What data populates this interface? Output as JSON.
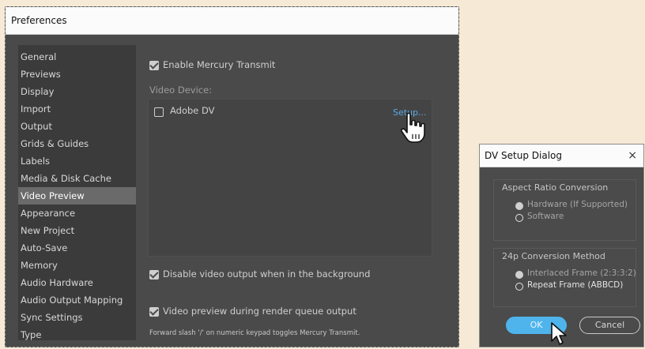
{
  "prefs": {
    "title": "Preferences",
    "sidebar": [
      {
        "label": "General"
      },
      {
        "label": "Previews"
      },
      {
        "label": "Display"
      },
      {
        "label": "Import"
      },
      {
        "label": "Output"
      },
      {
        "label": "Grids & Guides"
      },
      {
        "label": "Labels"
      },
      {
        "label": "Media & Disk Cache"
      },
      {
        "label": "Video Preview",
        "active": true
      },
      {
        "label": "Appearance"
      },
      {
        "label": "New Project"
      },
      {
        "label": "Auto-Save"
      },
      {
        "label": "Memory"
      },
      {
        "label": "Audio Hardware"
      },
      {
        "label": "Audio Output Mapping"
      },
      {
        "label": "Sync Settings"
      },
      {
        "label": "Type"
      }
    ],
    "enable_mercury": {
      "label": "Enable Mercury Transmit",
      "checked": true
    },
    "video_device_label": "Video Device:",
    "device": {
      "label": "Adobe DV",
      "checked": false
    },
    "setup_link": "Setup...",
    "disable_bg": {
      "label": "Disable video output when in the background",
      "checked": true
    },
    "render_queue": {
      "label": "Video preview during render queue output",
      "checked": true
    },
    "hint": "Forward slash '/' on numeric keypad toggles Mercury Transmit."
  },
  "dv_dialog": {
    "title": "DV Setup Dialog",
    "close_glyph": "×",
    "aspect": {
      "title": "Aspect Ratio Conversion",
      "options": [
        {
          "label": "Hardware (If Supported)",
          "selected": true
        },
        {
          "label": "Software",
          "selected": false
        }
      ]
    },
    "pulldown": {
      "title": "24p Conversion Method",
      "options": [
        {
          "label": "Interlaced Frame (2:3:3:2)",
          "selected": true
        },
        {
          "label": "Repeat Frame (ABBCD)",
          "selected": false
        }
      ]
    },
    "ok_label": "OK",
    "cancel_label": "Cancel"
  },
  "colors": {
    "accent": "#4fb4eb",
    "link": "#5aa9e6",
    "panel": "#4a4a4a",
    "sidebar": "#3b3b3b",
    "background": "#f6ead6"
  },
  "icons": {
    "hand_cursor": "pointing-hand-icon",
    "arrow_cursor": "arrow-cursor-icon"
  }
}
